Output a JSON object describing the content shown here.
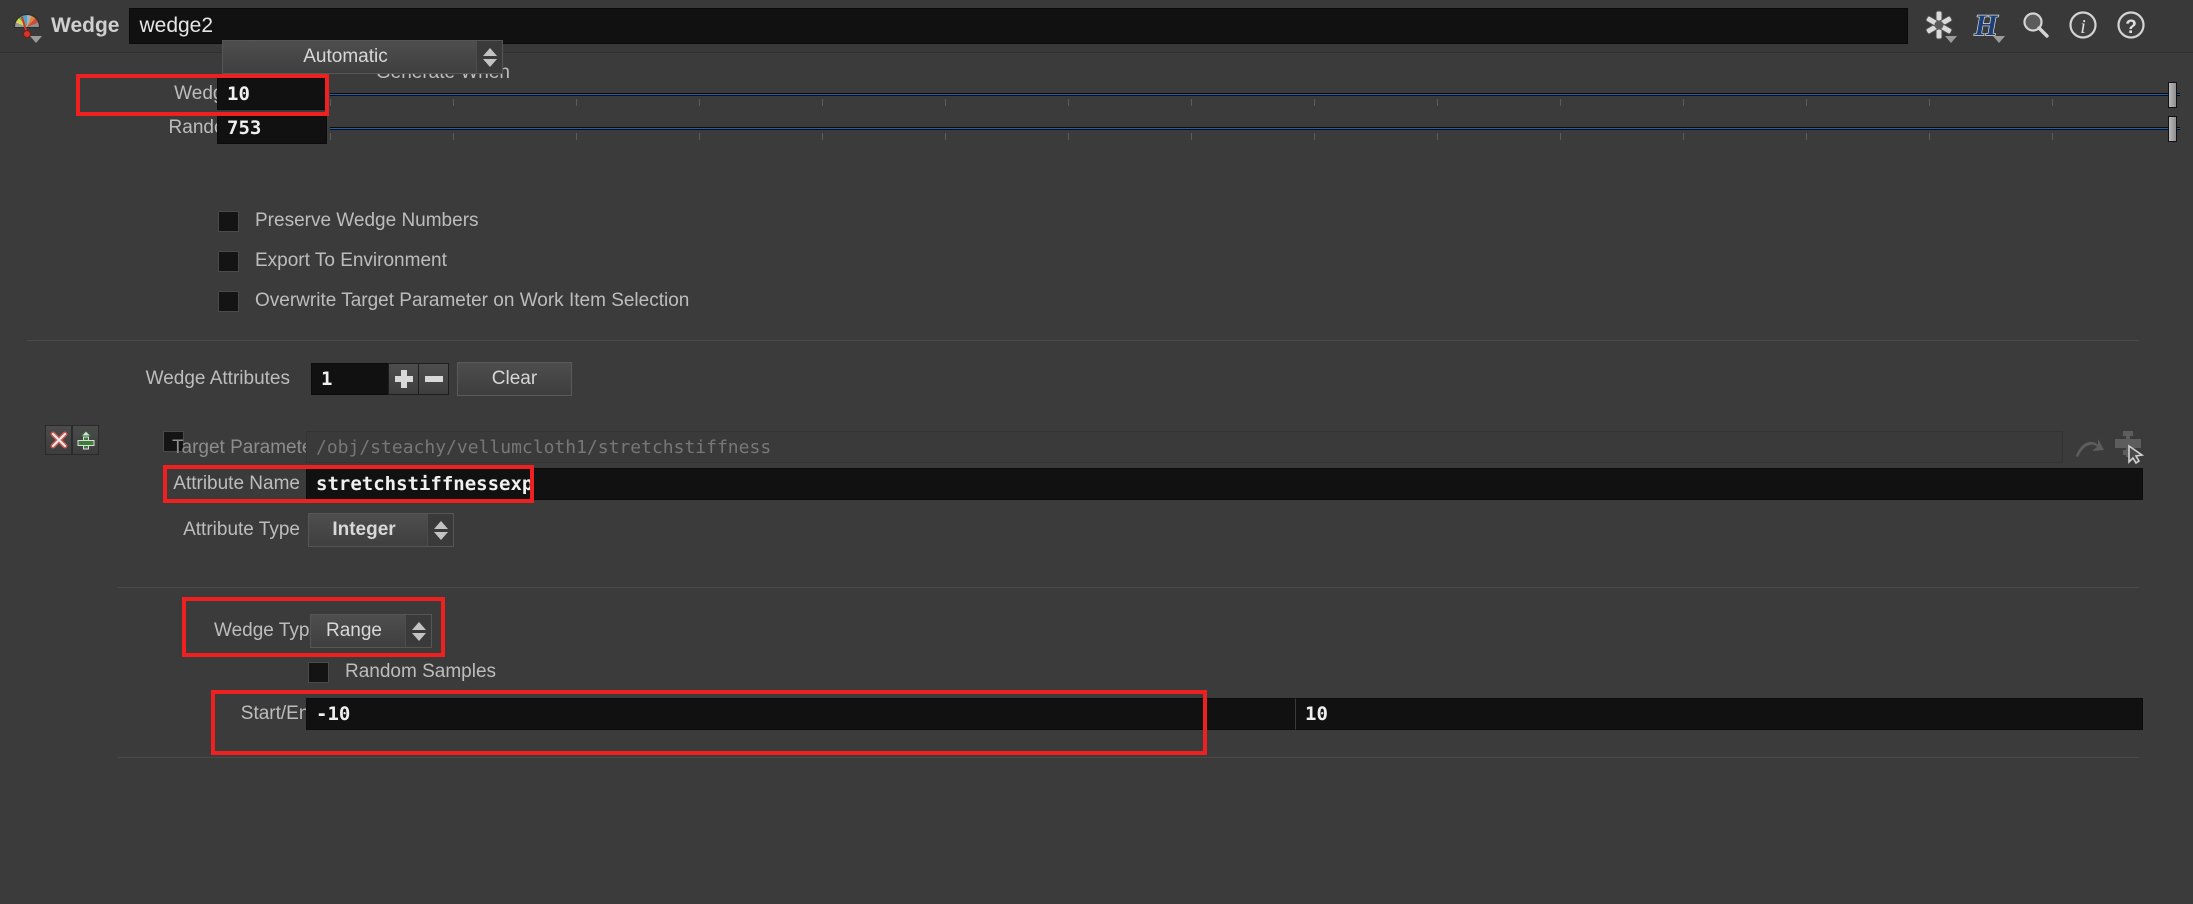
{
  "titlebar": {
    "node_icon": "wedge-node-icon",
    "op_label": "Wedge",
    "node_name": "wedge2",
    "icons": [
      {
        "name": "gear-icon",
        "has_dropdown": true
      },
      {
        "name": "houdini-h-icon",
        "has_dropdown": true,
        "glyph": "H"
      },
      {
        "name": "search-icon",
        "has_dropdown": false
      },
      {
        "name": "info-icon",
        "has_dropdown": false,
        "glyph": "i"
      },
      {
        "name": "help-icon",
        "has_dropdown": false,
        "glyph": "?"
      }
    ]
  },
  "params": {
    "generate_when": {
      "label": "Generate When",
      "value": "Automatic"
    },
    "wedge_count": {
      "label": "Wedge Count",
      "value": "10"
    },
    "random_seed": {
      "label": "Random Seed",
      "value": "753"
    },
    "preserve_wedge_numbers": {
      "label": "Preserve Wedge Numbers",
      "checked": false
    },
    "export_to_environment": {
      "label": "Export To Environment",
      "checked": false
    },
    "overwrite_target": {
      "label": "Overwrite Target Parameter on Work Item Selection",
      "checked": false
    },
    "wedge_attributes": {
      "label": "Wedge Attributes",
      "count": "1",
      "add_label": "+",
      "remove_label": "−",
      "clear_label": "Clear"
    },
    "target_parameter": {
      "label": "Target Parameter",
      "value": "/obj/steachy/vellumcloth1/stretchstiffness",
      "enabled": false
    },
    "attribute_name": {
      "label": "Attribute Name",
      "value": "stretchstiffnessexp"
    },
    "attribute_type": {
      "label": "Attribute Type",
      "value": "Integer"
    },
    "wedge_type": {
      "label": "Wedge Type",
      "value": "Range"
    },
    "random_samples": {
      "label": "Random Samples",
      "checked": false
    },
    "start_end": {
      "label": "Start/End",
      "start": "-10",
      "end": "10"
    }
  },
  "multiparm_buttons": {
    "delete": {
      "name": "delete-instance-button",
      "glyph": "✕"
    },
    "insert": {
      "name": "insert-instance-button",
      "glyph": "+"
    }
  },
  "target_row_icons": [
    {
      "name": "jump-to-parameter-icon"
    },
    {
      "name": "pick-parameter-icon"
    }
  ],
  "colors": {
    "background": "#3b3b3b",
    "panel": "#393939",
    "field": "#111111",
    "text": "#bdbdbd",
    "value_text": "#f0f0f0",
    "slider_blue": "#1f5fb5",
    "annotation_red": "#ef2020",
    "disabled_text": "#777777"
  },
  "annotations": [
    {
      "name": "annotation-wedge-count"
    },
    {
      "name": "annotation-attribute-name"
    },
    {
      "name": "annotation-wedge-type"
    },
    {
      "name": "annotation-start-end"
    }
  ]
}
